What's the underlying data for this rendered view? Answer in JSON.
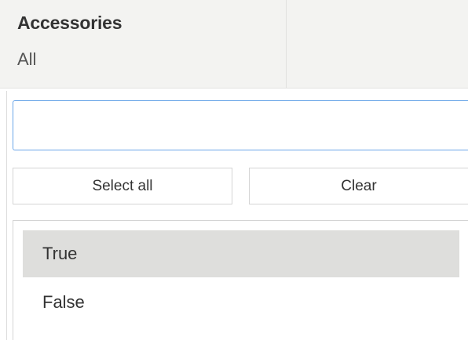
{
  "filter": {
    "title": "Accessories",
    "value": "All"
  },
  "search": {
    "value": "",
    "placeholder": ""
  },
  "actions": {
    "select_all_label": "Select all",
    "clear_label": "Clear"
  },
  "options": [
    {
      "label": "True",
      "highlighted": true
    },
    {
      "label": "False",
      "highlighted": false
    }
  ],
  "colors": {
    "header_bg": "#f3f3f1",
    "focus_border": "#6aa6e8",
    "highlight_bg": "#dededc"
  }
}
